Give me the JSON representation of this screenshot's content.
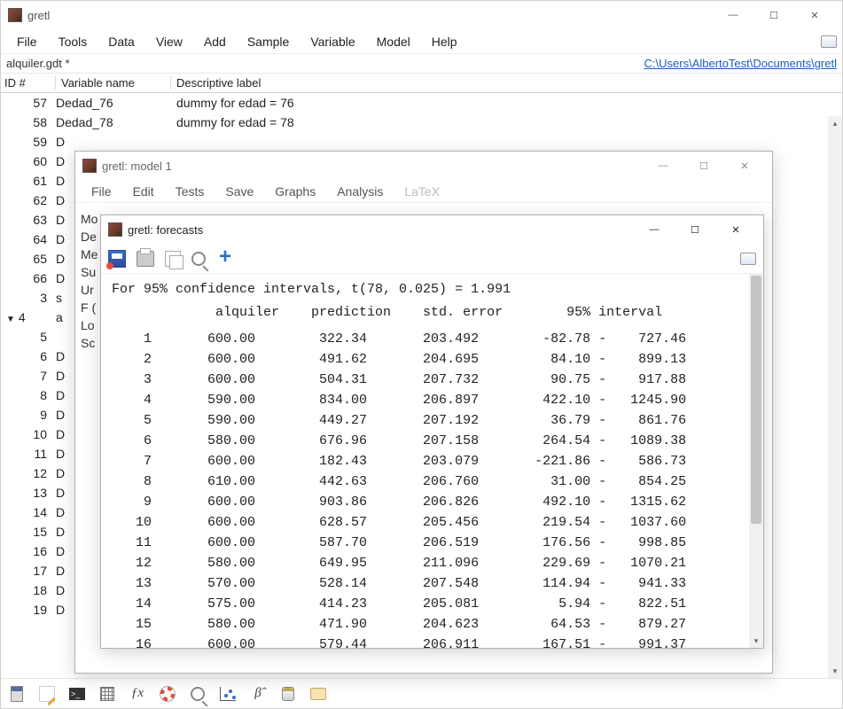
{
  "main": {
    "title": "gretl",
    "menu": [
      "File",
      "Tools",
      "Data",
      "View",
      "Add",
      "Sample",
      "Variable",
      "Model",
      "Help"
    ],
    "file_label": "alquiler.gdt *",
    "path": "C:\\Users\\AlbertoTest\\Documents\\gretl",
    "columns": {
      "id": "ID #",
      "var": "Variable name",
      "desc": "Descriptive label"
    },
    "rows": [
      {
        "id": "57",
        "var": "Dedad_76",
        "desc": "dummy for edad = 76"
      },
      {
        "id": "58",
        "var": "Dedad_78",
        "desc": "dummy for edad = 78"
      },
      {
        "id": "59",
        "var": "D",
        "desc": ""
      },
      {
        "id": "60",
        "var": "D",
        "desc": ""
      },
      {
        "id": "61",
        "var": "D",
        "desc": ""
      },
      {
        "id": "62",
        "var": "D",
        "desc": ""
      },
      {
        "id": "63",
        "var": "D",
        "desc": ""
      },
      {
        "id": "64",
        "var": "D",
        "desc": ""
      },
      {
        "id": "65",
        "var": "D",
        "desc": ""
      },
      {
        "id": "66",
        "var": "D",
        "desc": ""
      },
      {
        "id": "3",
        "var": "s",
        "desc": ""
      },
      {
        "id": "4",
        "var": "a",
        "desc": "",
        "tri": true
      },
      {
        "id": "5",
        "var": "",
        "desc": ""
      },
      {
        "id": "6",
        "var": "D",
        "desc": ""
      },
      {
        "id": "7",
        "var": "D",
        "desc": ""
      },
      {
        "id": "8",
        "var": "D",
        "desc": ""
      },
      {
        "id": "9",
        "var": "D",
        "desc": ""
      },
      {
        "id": "10",
        "var": "D",
        "desc": ""
      },
      {
        "id": "11",
        "var": "D",
        "desc": ""
      },
      {
        "id": "12",
        "var": "D",
        "desc": ""
      },
      {
        "id": "13",
        "var": "D",
        "desc": ""
      },
      {
        "id": "14",
        "var": "D",
        "desc": ""
      },
      {
        "id": "15",
        "var": "D",
        "desc": ""
      },
      {
        "id": "16",
        "var": "D",
        "desc": ""
      },
      {
        "id": "17",
        "var": "D",
        "desc": ""
      },
      {
        "id": "18",
        "var": "D",
        "desc": ""
      },
      {
        "id": "19",
        "var": "D",
        "desc": ""
      }
    ]
  },
  "model": {
    "title": "gretl: model 1",
    "menu": [
      "File",
      "Edit",
      "Tests",
      "Save",
      "Graphs",
      "Analysis"
    ],
    "menu_disabled": "LaTeX",
    "sidebar_frags": [
      "Mo",
      "De",
      "",
      "",
      "",
      "Me",
      "Su",
      "Ur",
      "F (",
      "Lo",
      "Sc"
    ]
  },
  "forecast": {
    "title": "gretl: forecasts",
    "header_line": "For 95% confidence intervals, t(78, 0.025) = 1.991",
    "col_header": "             alquiler    prediction    std. error        95% interval",
    "rows": [
      {
        "n": "1",
        "a": "600.00",
        "p": "322.34",
        "s": "203.492",
        "lo": "-82.78",
        "hi": "727.46"
      },
      {
        "n": "2",
        "a": "600.00",
        "p": "491.62",
        "s": "204.695",
        "lo": "84.10",
        "hi": "899.13"
      },
      {
        "n": "3",
        "a": "600.00",
        "p": "504.31",
        "s": "207.732",
        "lo": "90.75",
        "hi": "917.88"
      },
      {
        "n": "4",
        "a": "590.00",
        "p": "834.00",
        "s": "206.897",
        "lo": "422.10",
        "hi": "1245.90"
      },
      {
        "n": "5",
        "a": "590.00",
        "p": "449.27",
        "s": "207.192",
        "lo": "36.79",
        "hi": "861.76"
      },
      {
        "n": "6",
        "a": "580.00",
        "p": "676.96",
        "s": "207.158",
        "lo": "264.54",
        "hi": "1089.38"
      },
      {
        "n": "7",
        "a": "600.00",
        "p": "182.43",
        "s": "203.079",
        "lo": "-221.86",
        "hi": "586.73"
      },
      {
        "n": "8",
        "a": "610.00",
        "p": "442.63",
        "s": "206.760",
        "lo": "31.00",
        "hi": "854.25"
      },
      {
        "n": "9",
        "a": "600.00",
        "p": "903.86",
        "s": "206.826",
        "lo": "492.10",
        "hi": "1315.62"
      },
      {
        "n": "10",
        "a": "600.00",
        "p": "628.57",
        "s": "205.456",
        "lo": "219.54",
        "hi": "1037.60"
      },
      {
        "n": "11",
        "a": "600.00",
        "p": "587.70",
        "s": "206.519",
        "lo": "176.56",
        "hi": "998.85"
      },
      {
        "n": "12",
        "a": "580.00",
        "p": "649.95",
        "s": "211.096",
        "lo": "229.69",
        "hi": "1070.21"
      },
      {
        "n": "13",
        "a": "570.00",
        "p": "528.14",
        "s": "207.548",
        "lo": "114.94",
        "hi": "941.33"
      },
      {
        "n": "14",
        "a": "575.00",
        "p": "414.23",
        "s": "205.081",
        "lo": "5.94",
        "hi": "822.51"
      },
      {
        "n": "15",
        "a": "580.00",
        "p": "471.90",
        "s": "204.623",
        "lo": "64.53",
        "hi": "879.27"
      },
      {
        "n": "16",
        "a": "600.00",
        "p": "579.44",
        "s": "206.911",
        "lo": "167.51",
        "hi": "991.37"
      }
    ]
  }
}
